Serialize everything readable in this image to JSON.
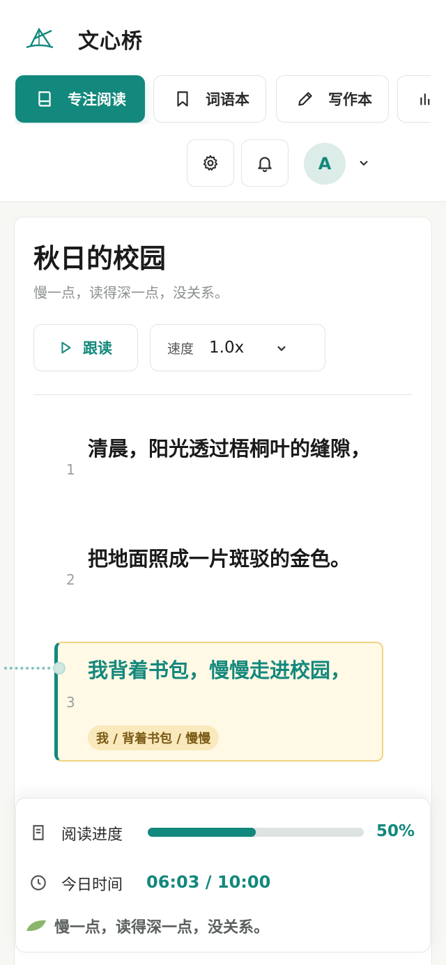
{
  "app": {
    "title": "文心桥"
  },
  "nav": {
    "tabs": [
      {
        "label": "专注阅读",
        "icon": "book-icon",
        "active": true
      },
      {
        "label": "词语本",
        "icon": "bookmark-icon",
        "active": false
      },
      {
        "label": "写作本",
        "icon": "pencil-icon",
        "active": false
      },
      {
        "label": "",
        "icon": "bar-chart-icon",
        "active": false
      }
    ]
  },
  "toolbar": {
    "settings_icon": "gear-icon",
    "notification_icon": "bell-icon",
    "avatar_initial": "A",
    "menu_icon": "chevron-down-icon"
  },
  "reader": {
    "title": "秋日的校园",
    "subtitle": "慢一点，读得深一点，没关系。",
    "follow_label": "跟读",
    "speed_label": "速度",
    "speed_value": "1.0x",
    "lines": [
      {
        "num": "1",
        "text": "清晨，阳光透过梧桐叶的缝隙，",
        "active": false
      },
      {
        "num": "2",
        "text": "把地面照成一片斑驳的金色。",
        "active": false
      },
      {
        "num": "3",
        "text": "我背着书包，慢慢走进校园，",
        "active": true,
        "chunks": "我 / 背着书包 / 慢慢"
      }
    ]
  },
  "progress": {
    "reading_label": "阅读进度",
    "reading_percent_text": "50%",
    "reading_fraction": 0.5,
    "time_label": "今日时间",
    "time_value": "06:03 / 10:00",
    "motto": "慢一点，读得深一点，没关系。"
  },
  "colors": {
    "accent": "#13887c",
    "highlight_bg": "#fff9e6",
    "highlight_border": "#f1d283"
  }
}
